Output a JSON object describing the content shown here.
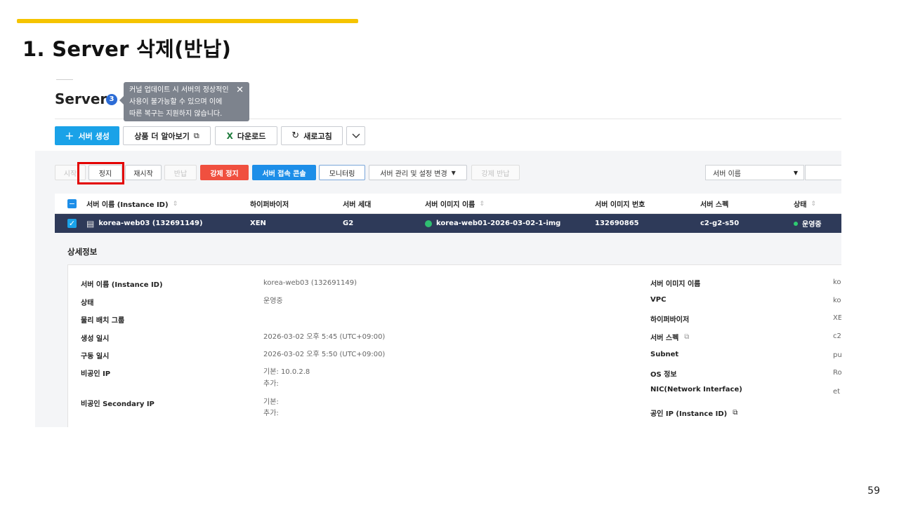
{
  "slide": {
    "title": "1. Server 삭제(반납)",
    "page_number": "59",
    "accent_color": "#f5c400"
  },
  "server_page": {
    "title": "Server",
    "count": "3",
    "tooltip": {
      "text": "커널 업데이트 시 서버의 정상적인\n사용이 불가능할 수 있으며 이에\n따른 복구는 지원하지 않습니다.",
      "close_icon": "close-icon"
    },
    "toolbar": {
      "create_label": "서버 생성",
      "learn_more_label": "상품 더 알아보기",
      "download_label": "다운로드",
      "refresh_label": "새로고침",
      "more_icon": "chevron-down-icon"
    },
    "actions": {
      "start_label": "시작",
      "stop_label": "정지",
      "restart_label": "재시작",
      "return_label": "반납",
      "force_stop_label": "강제 정지",
      "console_label": "서버 접속 콘솔",
      "monitoring_label": "모니터링",
      "manage_label": "서버 관리 및 설정 변경",
      "force_return_label": "강제 반납"
    },
    "search": {
      "select_value": "서버 이름"
    },
    "table": {
      "headers": {
        "name": "서버 이름 (Instance ID)",
        "hypervisor": "하이퍼바이저",
        "generation": "서버 세대",
        "image_name": "서버 이미지 이름",
        "image_no": "서버 이미지 번호",
        "spec": "서버 스펙",
        "status": "상태"
      },
      "rows": [
        {
          "name": "korea-web03 (132691149)",
          "hypervisor": "XEN",
          "generation": "G2",
          "image_name": "korea-web01-2026-03-02-1-img",
          "image_no": "132690865",
          "spec": "c2-g2-s50",
          "status": "운영중"
        }
      ]
    },
    "detail": {
      "title": "상세정보",
      "left": [
        {
          "label": "서버 이름 (Instance ID)",
          "value": "korea-web03 (132691149)"
        },
        {
          "label": "상태",
          "value": "운영중"
        },
        {
          "label": "물리 배치 그룹",
          "value": ""
        },
        {
          "label": "생성 일시",
          "value": "2026-03-02 오후 5:45 (UTC+09:00)"
        },
        {
          "label": "구동 일시",
          "value": "2026-03-02 오후 5:50 (UTC+09:00)"
        },
        {
          "label": "비공인 IP",
          "value": "기본: 10.0.2.8",
          "value2": "추가:"
        },
        {
          "label": "비공인 Secondary IP",
          "value": "기본:",
          "value2": "추가:"
        }
      ],
      "right": [
        {
          "label": "서버 이미지 이름",
          "value": "ko"
        },
        {
          "label": "VPC",
          "value": "ko"
        },
        {
          "label": "하이퍼바이저",
          "value": "XE"
        },
        {
          "label": "서버 스펙",
          "value": "c2"
        },
        {
          "label": "Subnet",
          "value": "pu"
        },
        {
          "label": "OS 정보",
          "value": "Ro"
        },
        {
          "label": "NIC(Network Interface)",
          "value": "et"
        },
        {
          "label": "공인 IP (Instance ID)",
          "value": ""
        }
      ]
    }
  }
}
